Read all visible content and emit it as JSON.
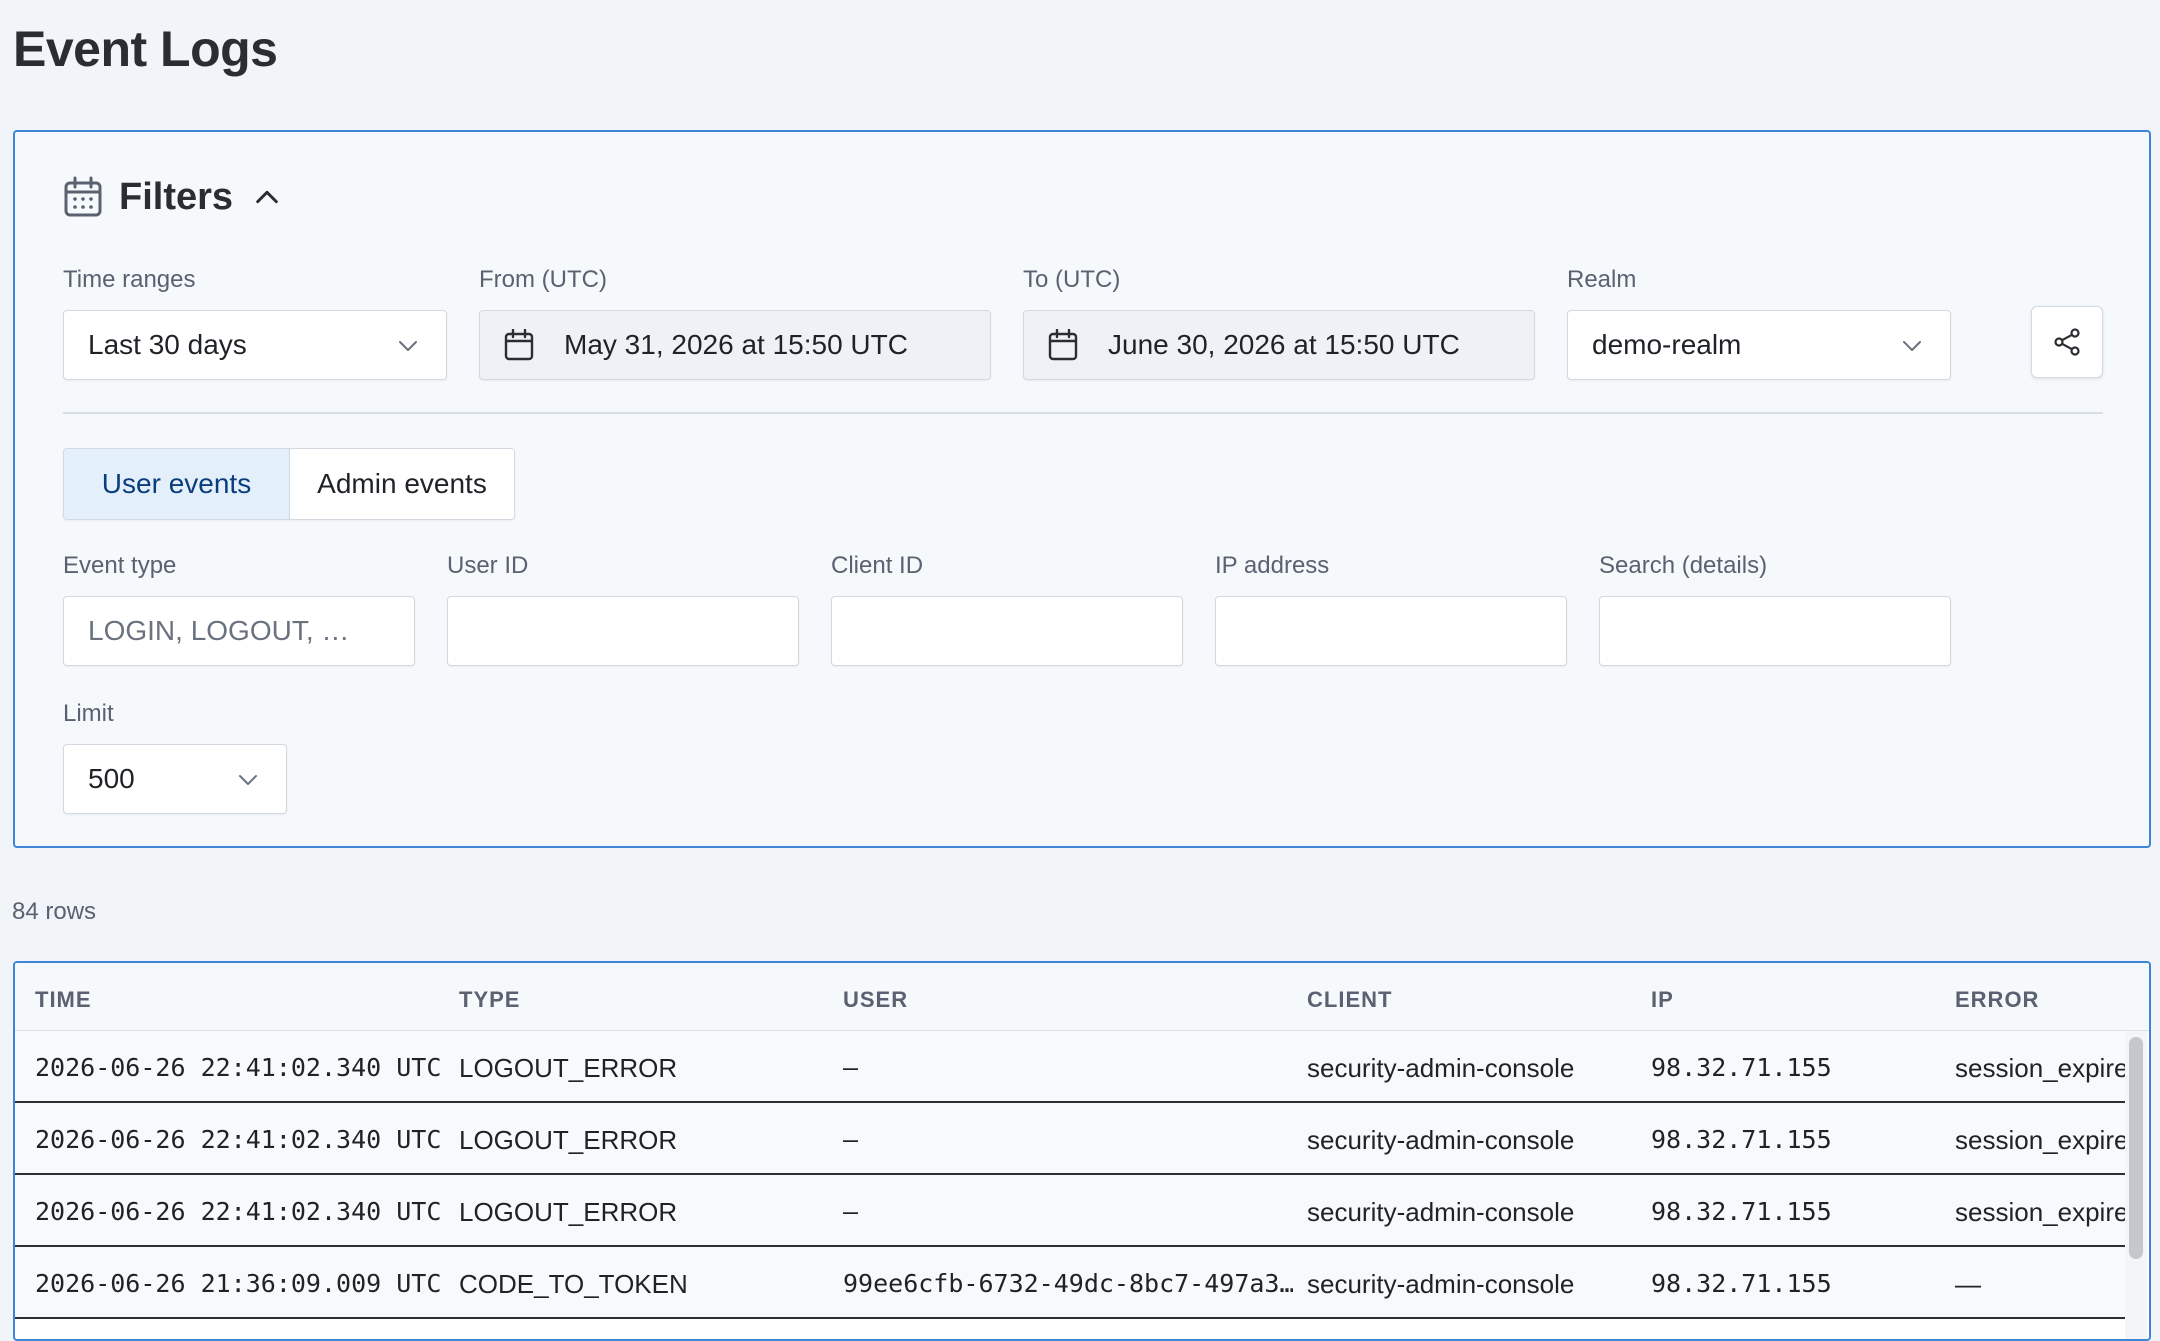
{
  "page": {
    "title": "Event Logs"
  },
  "filters": {
    "title": "Filters",
    "time_ranges": {
      "label": "Time ranges",
      "value": "Last 30 days"
    },
    "from": {
      "label": "From (UTC)",
      "value": "May 31, 2026 at 15:50 UTC"
    },
    "to": {
      "label": "To (UTC)",
      "value": "June 30, 2026 at 15:50 UTC"
    },
    "realm": {
      "label": "Realm",
      "value": "demo-realm"
    },
    "tabs": [
      {
        "label": "User events",
        "active": true
      },
      {
        "label": "Admin events",
        "active": false
      }
    ],
    "event_type": {
      "label": "Event type",
      "placeholder": "LOGIN, LOGOUT, …",
      "value": ""
    },
    "user_id": {
      "label": "User ID",
      "value": ""
    },
    "client_id": {
      "label": "Client ID",
      "value": ""
    },
    "ip_address": {
      "label": "IP address",
      "value": ""
    },
    "search": {
      "label": "Search (details)",
      "value": ""
    },
    "limit": {
      "label": "Limit",
      "value": "500"
    }
  },
  "results": {
    "count_text": "84 rows"
  },
  "table": {
    "columns": [
      "TIME",
      "TYPE",
      "USER",
      "CLIENT",
      "IP",
      "ERROR"
    ],
    "rows": [
      {
        "time": "2026-06-26 22:41:02.340 UTC",
        "type": "LOGOUT_ERROR",
        "user": "—",
        "client": "security-admin-console",
        "ip": "98.32.71.155",
        "error": "session_expired"
      },
      {
        "time": "2026-06-26 22:41:02.340 UTC",
        "type": "LOGOUT_ERROR",
        "user": "—",
        "client": "security-admin-console",
        "ip": "98.32.71.155",
        "error": "session_expired"
      },
      {
        "time": "2026-06-26 22:41:02.340 UTC",
        "type": "LOGOUT_ERROR",
        "user": "—",
        "client": "security-admin-console",
        "ip": "98.32.71.155",
        "error": "session_expired"
      },
      {
        "time": "2026-06-26 21:36:09.009 UTC",
        "type": "CODE_TO_TOKEN",
        "user": "99ee6cfb-6732-49dc-8bc7-497a3…",
        "client": "security-admin-console",
        "ip": "98.32.71.155",
        "error": "—"
      }
    ]
  },
  "colors": {
    "accent": "#3d86d6",
    "active_tab_bg": "#e3f0fc",
    "active_tab_text": "#0b3d7a"
  }
}
